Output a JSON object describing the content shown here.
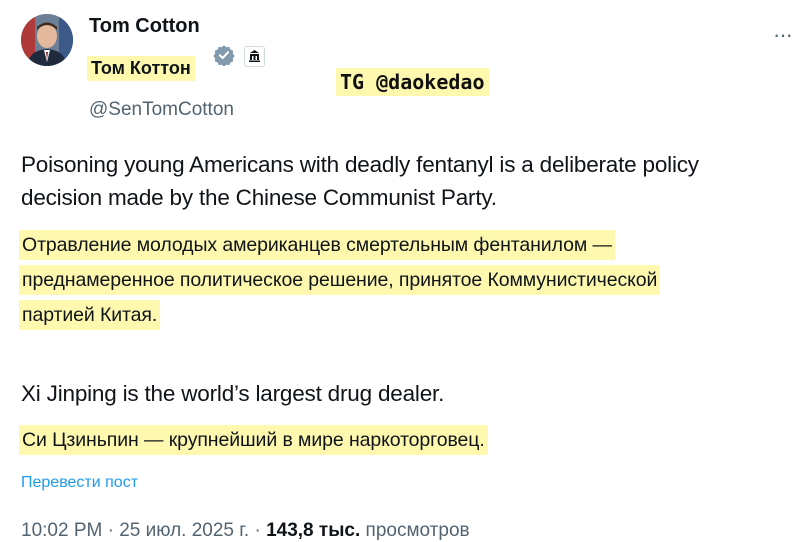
{
  "author": {
    "name": "Tom Cotton",
    "name_translated": "Том Коттон",
    "handle": "@SenTomCotton"
  },
  "watermark": "TG @daokedao",
  "tweet": {
    "para1_en": [
      "Poisoning young Americans with deadly fentanyl is a deliberate policy",
      "decision made by the Chinese Communist Party."
    ],
    "para1_ru": [
      "Отравление молодых американцев смертельным фентанилом —",
      "преднамеренное политическое решение, принятое Коммунистической",
      "партией Китая."
    ],
    "para2_en": "Xi Jinping is the world’s largest drug dealer.",
    "para2_ru": "Си Цзиньпин — крупнейший в мире наркоторговец."
  },
  "translate_link": "Перевести пост",
  "meta": {
    "time": "10:02 PM",
    "date": "25 июл. 2025 г.",
    "views_count": "143,8 тыс.",
    "views_label": "просмотров"
  },
  "colors": {
    "highlight": "#fff9b0",
    "link": "#1d9bf0",
    "verified": "#829aab",
    "secondary_text": "#536471"
  },
  "icons": [
    "verified-badge-icon",
    "government-badge-icon",
    "more-options-icon"
  ]
}
